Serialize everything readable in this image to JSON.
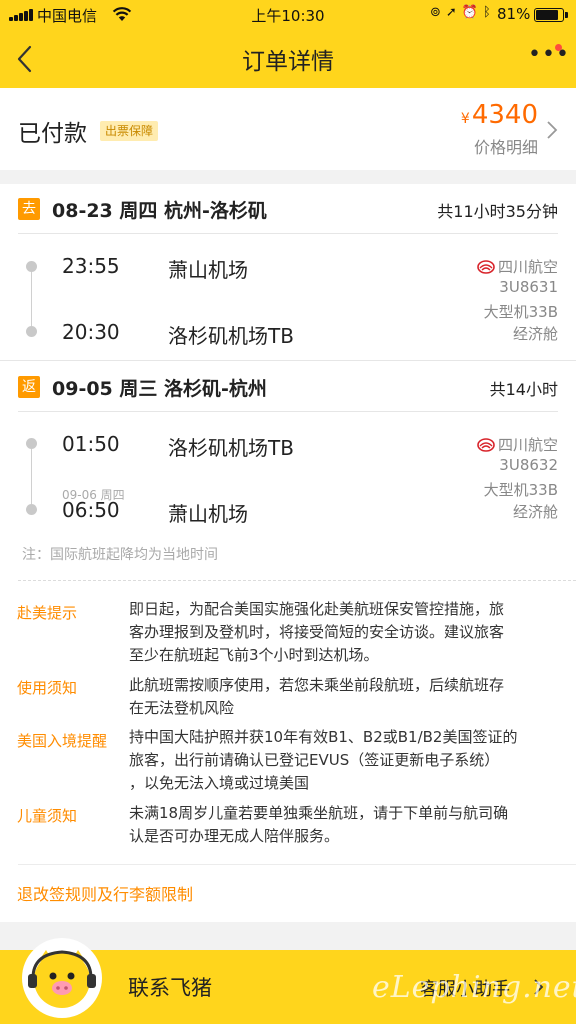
{
  "status_bar": {
    "carrier": "中国电信",
    "time": "上午10:30",
    "battery": "81%"
  },
  "nav": {
    "title": "订单详情",
    "back_icon": "chevron-left-icon",
    "more_icon": "more-dots-icon"
  },
  "order": {
    "status": "已付款",
    "guarantee_badge": "出票保障",
    "currency_symbol": "¥",
    "price": "4340",
    "price_detail": "价格明细"
  },
  "segments": [
    {
      "tag": "去",
      "title": "08-23 周四 杭州-洛杉矶",
      "duration": "共11小时35分钟",
      "depart_time": "23:55",
      "depart_airport": "萧山机场",
      "arrive_date": "",
      "arrive_time": "20:30",
      "arrive_airport": "洛杉矶机场TB",
      "airline": "四川航空",
      "flight_no": "3U8631",
      "aircraft": "大型机33B",
      "cabin": "经济舱"
    },
    {
      "tag": "返",
      "title": "09-05 周三 洛杉矶-杭州",
      "duration": "共14小时",
      "depart_time": "01:50",
      "depart_airport": "洛杉矶机场TB",
      "arrive_date": "09-06 周四",
      "arrive_time": "06:50",
      "arrive_airport": "萧山机场",
      "airline": "四川航空",
      "flight_no": "3U8632",
      "aircraft": "大型机33B",
      "cabin": "经济舱"
    }
  ],
  "note": "注：国际航班起降均为当地时间",
  "tips": [
    {
      "label": "赴美提示",
      "lines": [
        "即日起，为配合美国实施强化赴美航班保安管控措施，旅",
        "客办理报到及登机时，将接受简短的安全访谈。建议旅客",
        "至少在航班起飞前3个小时到达机场。"
      ]
    },
    {
      "label": "使用须知",
      "lines": [
        "此航班需按顺序使用，若您未乘坐前段航班，后续航班存",
        "在无法登机风险"
      ]
    },
    {
      "label": "美国入境提醒",
      "lines": [
        "持中国大陆护照并获10年有效B1、B2或B1/B2美国签证的",
        "旅客，出行前请确认已登记EVUS（签证更新电子系统）",
        "，以免无法入境或过境美国"
      ]
    },
    {
      "label": "儿童须知",
      "lines": [
        "未满18周岁儿童若要单独乘坐航班，请于下单前与航司确",
        "认是否可办理无成人陪伴服务。"
      ]
    }
  ],
  "refund_link": "退改签规则及行李额限制",
  "bottom": {
    "contact": "联系飞猪",
    "assistant": "客服小助手",
    "watermark": "eLephing.net"
  },
  "colors": {
    "brand_yellow": "#ffd51c",
    "accent_orange": "#ff8c00",
    "price_orange": "#ff6a00"
  }
}
